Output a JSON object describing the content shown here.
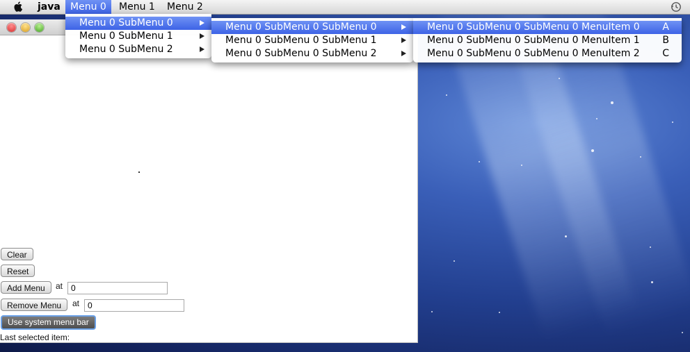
{
  "menubar": {
    "app_name": "java",
    "menus": [
      "Menu 0",
      "Menu 1",
      "Menu 2"
    ]
  },
  "window": {
    "buttons": {
      "clear": "Clear",
      "reset": "Reset",
      "add_menu": "Add Menu",
      "remove_menu": "Remove Menu",
      "use_system_menu_bar": "Use system menu bar"
    },
    "labels": {
      "at_add": "at",
      "at_remove": "at",
      "last_selected": "Last selected item:"
    },
    "fields": {
      "add_index": "0",
      "remove_index": "0"
    }
  },
  "dropdown_level1": {
    "items": [
      "Menu 0 SubMenu 0",
      "Menu 0 SubMenu 1",
      "Menu 0 SubMenu 2"
    ]
  },
  "dropdown_level2": {
    "items": [
      "Menu 0 SubMenu 0 SubMenu 0",
      "Menu 0 SubMenu 0 SubMenu 1",
      "Menu 0 SubMenu 0 SubMenu 2"
    ]
  },
  "dropdown_level3": {
    "items": [
      {
        "label": "Menu 0 SubMenu 0 SubMenu 0 MenuItem 0",
        "shortcut": "A"
      },
      {
        "label": "Menu 0 SubMenu 0 SubMenu 0 MenuItem 1",
        "shortcut": "B"
      },
      {
        "label": "Menu 0 SubMenu 0 SubMenu 0 MenuItem 2",
        "shortcut": "C"
      }
    ]
  },
  "icons": {
    "apple": "apple-logo-icon",
    "time_machine": "time-machine-icon",
    "submenu_arrow": "submenu-arrow-icon"
  },
  "colors": {
    "menu_highlight": "#3d63e6",
    "desktop_blue": "#223f8f"
  }
}
